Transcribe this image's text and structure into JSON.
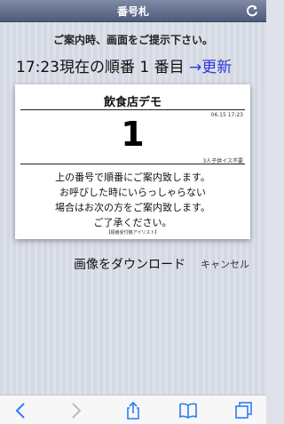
{
  "navbar": {
    "title": "番号札"
  },
  "instruction": "ご案内時、画面をご提示下さい。",
  "status": {
    "text": "17:23現在の順番 1 番目",
    "update_label": "→更新"
  },
  "ticket": {
    "store_name": "飲食店デモ",
    "issued_at": "06.15 17:23",
    "number": "1",
    "party_info": "3人子供イス不要",
    "message_lines": [
      "上の番号で順番にご案内致します。",
      "お呼びした時にいらっしゃらない",
      "場合はお次の方をご案内致します。",
      "ご了承ください。"
    ],
    "footer": "【順番受付機アイリスト】"
  },
  "actions": {
    "download_label": "画像をダウンロード",
    "cancel_label": "キャンセル"
  },
  "toolbar": {
    "icons": [
      "back-icon",
      "forward-icon",
      "share-icon",
      "bookmarks-icon",
      "tabs-icon"
    ],
    "accent_color": "#2f7bf5"
  }
}
